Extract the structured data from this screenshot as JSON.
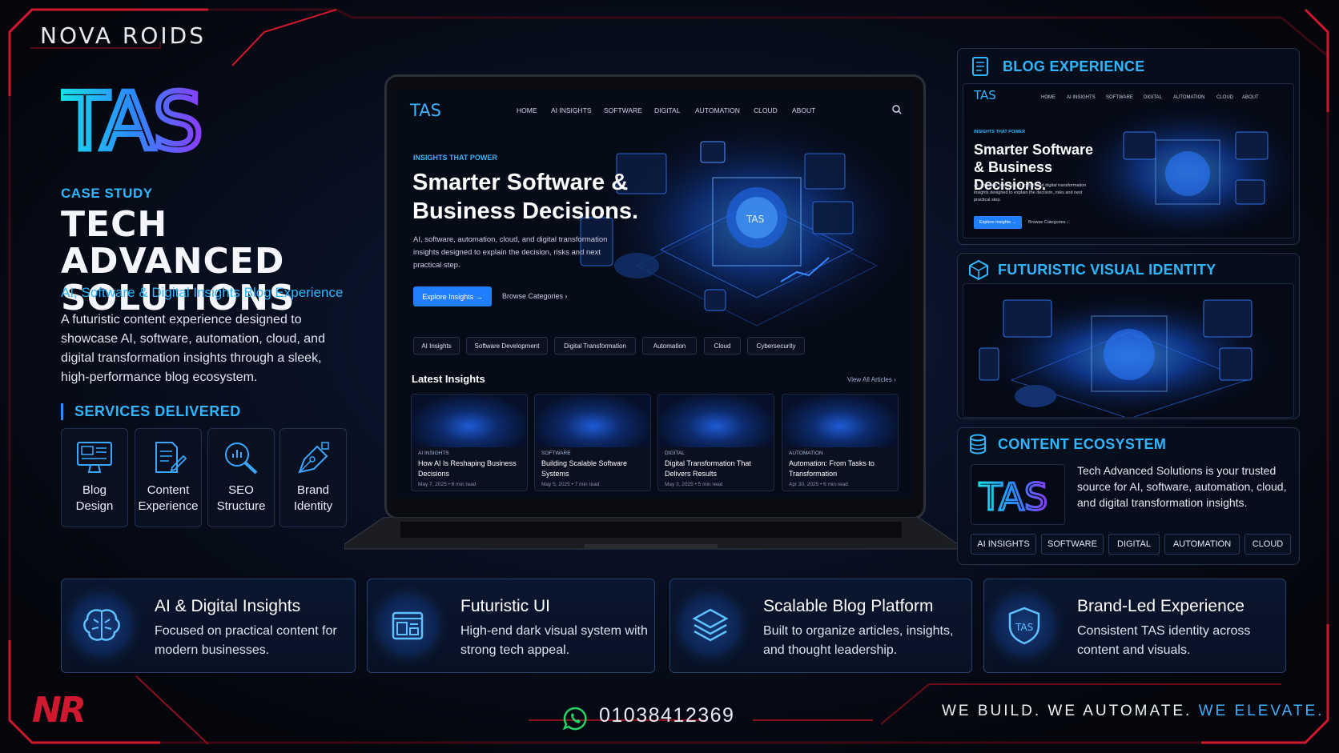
{
  "brand": "NOVA ROIDS",
  "logo": {
    "text": "TAS"
  },
  "case_label": "CASE STUDY",
  "title": "TECH ADVANCED SOLUTIONS",
  "subtitle": "AI, Software & Digital Insights Blog Experience",
  "description": "A futuristic content experience designed to showcase AI, software, automation, cloud, and digital transformation insights through a sleek, high-performance blog ecosystem.",
  "services": {
    "heading": "SERVICES DELIVERED",
    "items": [
      {
        "line1": "Blog",
        "line2": "Design",
        "icon": "monitor-icon"
      },
      {
        "line1": "Content",
        "line2": "Experience",
        "icon": "document-edit-icon"
      },
      {
        "line1": "SEO",
        "line2": "Structure",
        "icon": "magnifier-chart-icon"
      },
      {
        "line1": "Brand",
        "line2": "Identity",
        "icon": "pen-tool-icon"
      }
    ]
  },
  "laptop": {
    "logo": "TAS",
    "nav": [
      "HOME",
      "AI INSIGHTS",
      "SOFTWARE",
      "DIGITAL",
      "AUTOMATION",
      "CLOUD",
      "ABOUT"
    ],
    "kicker": "INSIGHTS THAT POWER",
    "hero_title": "Smarter Software & Business Decisions.",
    "hero_sub": "AI, software, automation, cloud, and digital transformation insights designed to explain the decision, risks and next practical step.",
    "primary_btn": "Explore Insights →",
    "secondary_btn": "Browse Categories ›",
    "chips": [
      "AI Insights",
      "Software Development",
      "Digital Transformation",
      "Automation",
      "Cloud",
      "Cybersecurity"
    ],
    "latest_title": "Latest Insights",
    "view_all": "View All Articles ›",
    "cards": [
      {
        "category": "AI INSIGHTS",
        "title": "How AI Is Reshaping Business Decisions",
        "meta": "May 7, 2025  •  6 min read"
      },
      {
        "category": "SOFTWARE",
        "title": "Building Scalable Software Systems",
        "meta": "May 5, 2025  •  7 min read"
      },
      {
        "category": "DIGITAL",
        "title": "Digital Transformation That Delivers Results",
        "meta": "May 3, 2025  •  5 min read"
      },
      {
        "category": "AUTOMATION",
        "title": "Automation: From Tasks to Transformation",
        "meta": "Apr 30, 2025  •  6 min read"
      }
    ]
  },
  "panels": {
    "blog": {
      "title": "BLOG EXPERIENCE",
      "logo": "TAS",
      "nav": [
        "HOME",
        "AI INSIGHTS",
        "SOFTWARE",
        "DIGITAL",
        "AUTOMATION",
        "CLOUD",
        "ABOUT"
      ],
      "kicker": "INSIGHTS THAT POWER",
      "hero_title": "Smarter Software & Business Decisions.",
      "hero_sub": "AI, software, automation, cloud, and digital transformation insights designed to explain the decision, risks and next practical step.",
      "primary_btn": "Explore Insights →",
      "secondary_btn": "Browse Categories ›"
    },
    "visual": {
      "title": "FUTURISTIC VISUAL IDENTITY"
    },
    "ecosystem": {
      "title": "CONTENT ECOSYSTEM",
      "text": "Tech Advanced Solutions is your trusted source for AI, software, automation, cloud, and digital transformation insights.",
      "tags": [
        "AI INSIGHTS",
        "SOFTWARE",
        "DIGITAL",
        "AUTOMATION",
        "CLOUD"
      ]
    }
  },
  "features": [
    {
      "title": "AI & Digital Insights",
      "desc": "Focused on practical content for modern businesses.",
      "icon": "brain-icon"
    },
    {
      "title": "Futuristic UI",
      "desc": "High-end dark visual system with strong tech appeal.",
      "icon": "browser-layout-icon"
    },
    {
      "title": "Scalable Blog Platform",
      "desc": "Built to organize articles, insights, and thought leadership.",
      "icon": "layers-icon"
    },
    {
      "title": "Brand-Led Experience",
      "desc": "Consistent TAS identity across content and visuals.",
      "icon": "shield-icon"
    }
  ],
  "footer": {
    "nr_logo": "NR",
    "phone": "01038412369",
    "slogan_main": "WE BUILD. WE AUTOMATE.",
    "slogan_accent": "WE ELEVATE."
  },
  "colors": {
    "accent": "#2fb6ff",
    "frame_red": "#c0142a",
    "background": "#04060c"
  }
}
